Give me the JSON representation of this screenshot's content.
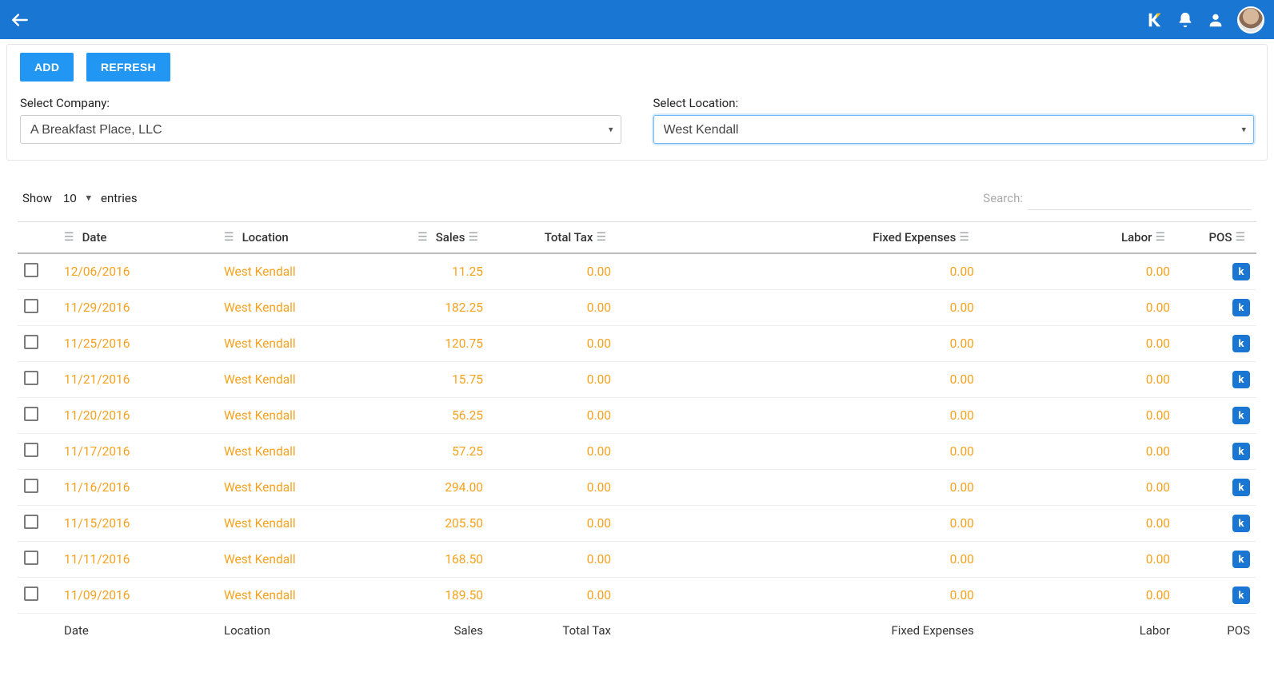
{
  "topbar": {
    "logo_text": "k"
  },
  "toolbar": {
    "add_label": "ADD",
    "refresh_label": "REFRESH"
  },
  "filters": {
    "company_label": "Select Company:",
    "company_value": "A Breakfast Place, LLC",
    "location_label": "Select Location:",
    "location_value": "West Kendall"
  },
  "table_ctl": {
    "show_label": "Show",
    "entries_label": "entries",
    "page_size": "10",
    "search_label": "Search:",
    "search_value": ""
  },
  "columns": {
    "checkbox": "",
    "date": "Date",
    "location": "Location",
    "sales": "Sales",
    "total_tax": "Total Tax",
    "fixed_expenses": "Fixed Expenses",
    "labor": "Labor",
    "pos": "POS"
  },
  "rows": [
    {
      "date": "12/06/2016",
      "location": "West Kendall",
      "sales": "11.25",
      "total_tax": "0.00",
      "fixed_expenses": "0.00",
      "labor": "0.00"
    },
    {
      "date": "11/29/2016",
      "location": "West Kendall",
      "sales": "182.25",
      "total_tax": "0.00",
      "fixed_expenses": "0.00",
      "labor": "0.00"
    },
    {
      "date": "11/25/2016",
      "location": "West Kendall",
      "sales": "120.75",
      "total_tax": "0.00",
      "fixed_expenses": "0.00",
      "labor": "0.00"
    },
    {
      "date": "11/21/2016",
      "location": "West Kendall",
      "sales": "15.75",
      "total_tax": "0.00",
      "fixed_expenses": "0.00",
      "labor": "0.00"
    },
    {
      "date": "11/20/2016",
      "location": "West Kendall",
      "sales": "56.25",
      "total_tax": "0.00",
      "fixed_expenses": "0.00",
      "labor": "0.00"
    },
    {
      "date": "11/17/2016",
      "location": "West Kendall",
      "sales": "57.25",
      "total_tax": "0.00",
      "fixed_expenses": "0.00",
      "labor": "0.00"
    },
    {
      "date": "11/16/2016",
      "location": "West Kendall",
      "sales": "294.00",
      "total_tax": "0.00",
      "fixed_expenses": "0.00",
      "labor": "0.00"
    },
    {
      "date": "11/15/2016",
      "location": "West Kendall",
      "sales": "205.50",
      "total_tax": "0.00",
      "fixed_expenses": "0.00",
      "labor": "0.00"
    },
    {
      "date": "11/11/2016",
      "location": "West Kendall",
      "sales": "168.50",
      "total_tax": "0.00",
      "fixed_expenses": "0.00",
      "labor": "0.00"
    },
    {
      "date": "11/09/2016",
      "location": "West Kendall",
      "sales": "189.50",
      "total_tax": "0.00",
      "fixed_expenses": "0.00",
      "labor": "0.00"
    }
  ],
  "footer": {
    "date": "Date",
    "location": "Location",
    "sales": "Sales",
    "total_tax": "Total Tax",
    "fixed_expenses": "Fixed Expenses",
    "labor": "Labor",
    "pos": "POS"
  },
  "icons": {
    "pos_badge_text": "k"
  }
}
